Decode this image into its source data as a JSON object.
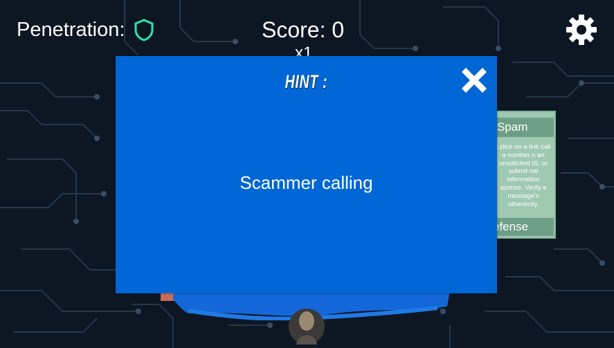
{
  "hud": {
    "penetration_label": "Penetration:",
    "score_label": "Score: 0",
    "multiplier": "x1"
  },
  "card": {
    "title": "Spam",
    "description": "t click on a link call a number n an unsolicited IS, or submit nal information sponse. Verify e message's uthenticity.",
    "footer": "efense"
  },
  "modal": {
    "title": "HINT :",
    "message": "Scammer calling"
  },
  "colors": {
    "modal_bg": "#0267d6",
    "shield": "#2ee6b0",
    "card_bg": "#9fc9b1",
    "background": "#0d1724"
  },
  "icons": [
    "shield-icon",
    "gear-icon",
    "close-icon"
  ]
}
